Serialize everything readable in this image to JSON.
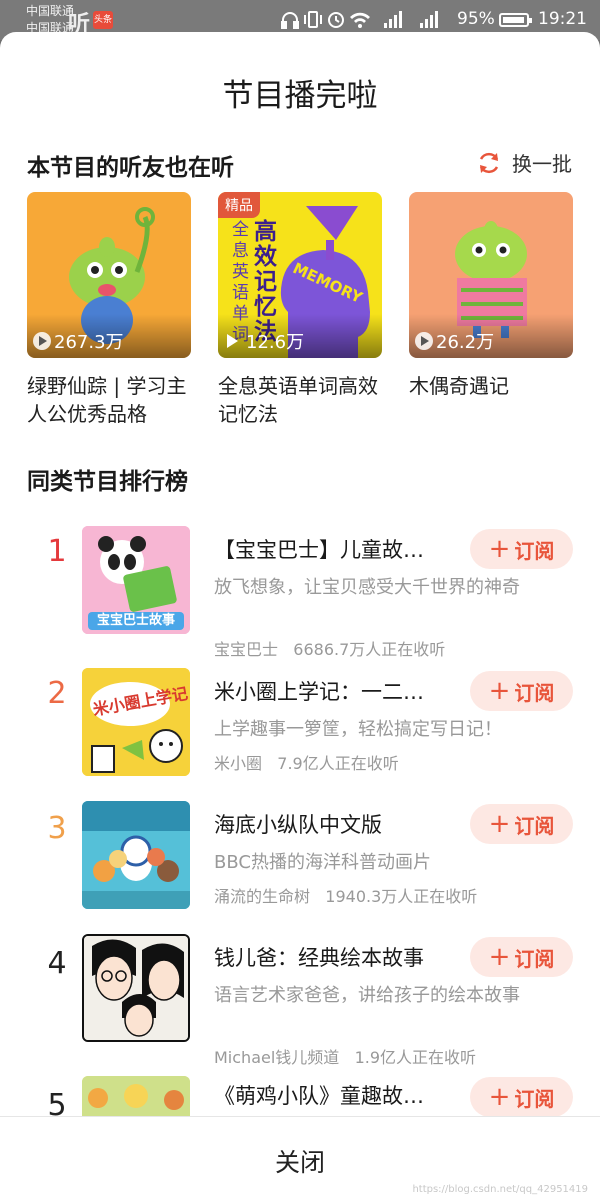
{
  "status_bar": {
    "carrier1": "中国联通",
    "carrier2": "中国联通",
    "app_glyph": "听",
    "app_badge": "头条",
    "icons": [
      "headphones-icon",
      "vibrate-icon",
      "alarm-icon",
      "wifi-icon",
      "signal-4g-icon",
      "signal-4g-icon"
    ],
    "battery": "95%",
    "battery_level": 0.95,
    "time": "19:21"
  },
  "sheet": {
    "title": "节目播完啦",
    "section1": "本节目的听友也在听",
    "refresh_label": "换一批",
    "recommendations": [
      {
        "plays": "267.3万",
        "name": "绿野仙踪 | 学习主人公优秀品格",
        "badge": "",
        "cover": "green-frog-cartoon"
      },
      {
        "plays": "12.6万",
        "name": "全息英语单词高效记忆法",
        "badge": "精品",
        "cover_text": "全息英语单词",
        "cover_title": "高效记忆法",
        "cover_word": "MEMORY"
      },
      {
        "plays": "26.2万",
        "name": "木偶奇遇记",
        "badge": "",
        "cover": "green-frog-gift"
      }
    ],
    "section2": "同类节目排行榜",
    "subscribe_label": "订阅",
    "ranking": [
      {
        "rank": "1",
        "color": "#e4393c",
        "title": "【宝宝巴士】儿童故…",
        "desc": "放飞想象，让宝贝感受大千世界的神奇",
        "author": "宝宝巴士",
        "listeners": "6686.7万人正在收听",
        "cover_text": "宝宝巴士故事"
      },
      {
        "rank": "2",
        "color": "#ec6a45",
        "title": "米小圈上学记：一二…",
        "desc": "上学趣事一箩筐，轻松搞定写日记！",
        "author": "米小圈",
        "listeners": "7.9亿人正在收听",
        "cover_text": "米小圈上学记"
      },
      {
        "rank": "3",
        "color": "#f0a04b",
        "title": "海底小纵队中文版",
        "desc": "BBC热播的海洋科普动画片",
        "author": "涌流的生命树",
        "listeners": "1940.3万人正在收听"
      },
      {
        "rank": "4",
        "color": "#222222",
        "title": "钱儿爸：经典绘本故事",
        "desc": "语言艺术家爸爸，讲给孩子的绘本故事",
        "author": "Michael钱儿频道",
        "listeners": "1.9亿人正在收听"
      },
      {
        "rank": "5",
        "color": "#222222",
        "title": "《萌鸡小队》童趣故…"
      }
    ],
    "close_label": "关闭",
    "watermark": "https://blog.csdn.net/qq_42951419"
  }
}
